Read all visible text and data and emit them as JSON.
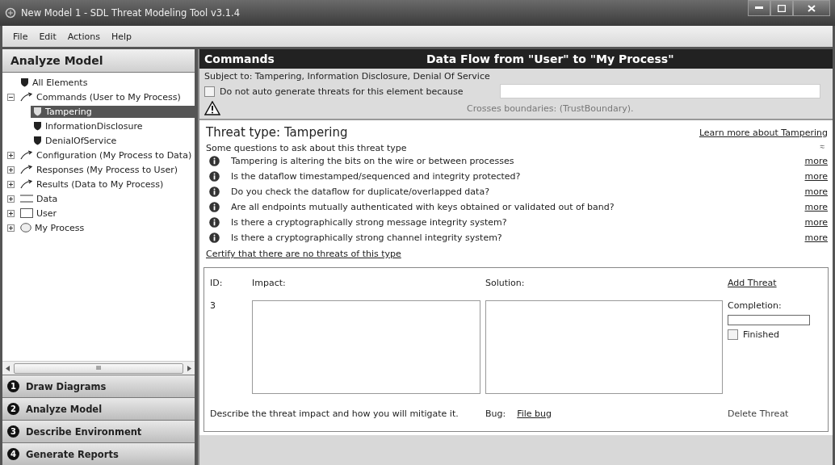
{
  "window": {
    "title": "New Model 1 - SDL Threat Modeling Tool v3.1.4"
  },
  "menu": [
    "File",
    "Edit",
    "Actions",
    "Help"
  ],
  "sidebar": {
    "title": "Analyze Model",
    "tree": [
      {
        "label": "All Elements",
        "kind": "threat",
        "selected": false
      },
      {
        "label": "Commands (User to My Process)",
        "kind": "flow",
        "selected": false,
        "expanded": true,
        "children": [
          {
            "label": "Tampering",
            "kind": "threat",
            "selected": true
          },
          {
            "label": "InformationDisclosure",
            "kind": "threat",
            "selected": false
          },
          {
            "label": "DenialOfService",
            "kind": "threat",
            "selected": false
          }
        ]
      },
      {
        "label": "Configuration (My Process to Data)",
        "kind": "flow",
        "selected": false,
        "expanded": false
      },
      {
        "label": "Responses (My Process to User)",
        "kind": "flow",
        "selected": false,
        "expanded": false
      },
      {
        "label": "Results (Data to My Process)",
        "kind": "flow",
        "selected": false,
        "expanded": false
      },
      {
        "label": "Data",
        "kind": "store",
        "selected": false,
        "expanded": false
      },
      {
        "label": "User",
        "kind": "entity",
        "selected": false,
        "expanded": false
      },
      {
        "label": "My Process",
        "kind": "process",
        "selected": false,
        "expanded": false
      }
    ],
    "scrollbar_grip": "III",
    "steps": [
      {
        "number": "1",
        "label": "Draw Diagrams"
      },
      {
        "number": "2",
        "label": "Analyze Model"
      },
      {
        "number": "3",
        "label": "Describe Environment"
      },
      {
        "number": "4",
        "label": "Generate Reports"
      }
    ]
  },
  "element": {
    "name": "Commands",
    "heading": "Data Flow from \"User\" to \"My Process\"",
    "subject": "Subject to: Tampering, Information Disclosure, Denial Of Service",
    "auto_generate_label": "Do not auto generate threats for this element because",
    "auto_generate_checked": false,
    "warning": "Crosses boundaries: (TrustBoundary)."
  },
  "threat_type": {
    "title": "Threat type: Tampering",
    "learn_more": "Learn more about Tampering",
    "questions_title": "Some questions to ask about this threat type",
    "collapse_glyph": "≈",
    "questions": [
      {
        "text": "Tampering is altering the bits on the wire or between processes",
        "link": "more"
      },
      {
        "text": "Is the dataflow timestamped/sequenced and integrity protected?",
        "link": "more"
      },
      {
        "text": "Do you check the dataflow for duplicate/overlapped data?",
        "link": "more"
      },
      {
        "text": "Are all endpoints mutually authenticated with keys obtained or validated out of band?",
        "link": "more"
      },
      {
        "text": "Is there a cryptographically strong message integrity system?",
        "link": "more"
      },
      {
        "text": "Is there a cryptographically strong channel integrity system?",
        "link": "more"
      }
    ],
    "certify": "Certify that there are no threats of this type"
  },
  "threat": {
    "id_label": "ID:",
    "impact_label": "Impact:",
    "solution_label": "Solution:",
    "add": "Add Threat",
    "id": "3",
    "completion_label": "Completion:",
    "level": 0,
    "finished_label": "Finished",
    "finished": false,
    "hint": "Describe the threat impact and how you will mitigate it.",
    "bug_label": "Bug:",
    "file_bug": "File bug",
    "delete": "Delete Threat"
  }
}
